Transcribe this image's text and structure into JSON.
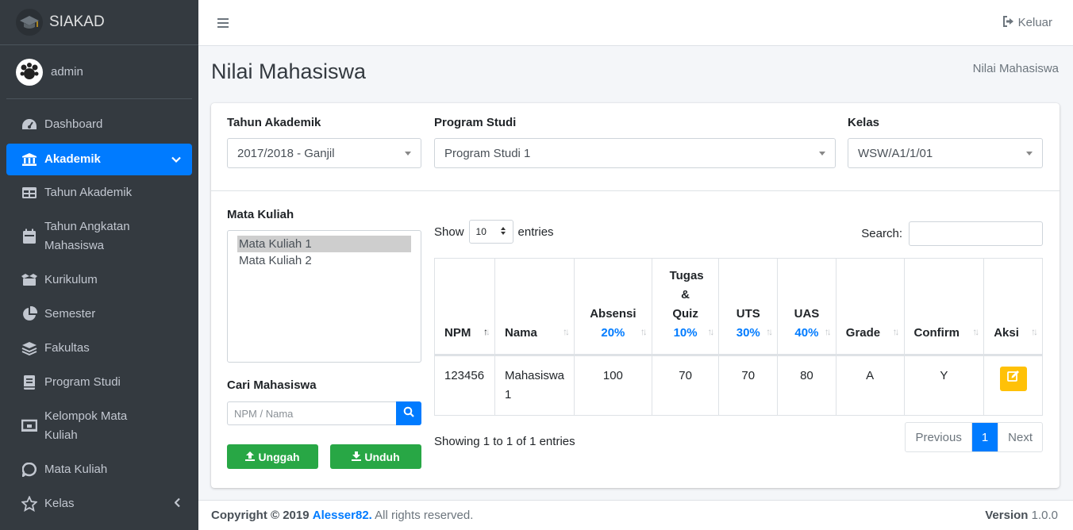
{
  "brand": {
    "name": "SIAKAD"
  },
  "user": {
    "name": "admin"
  },
  "sidebar": {
    "items": [
      {
        "label": "Dashboard",
        "icon": "dashboard-icon"
      },
      {
        "label": "Akademik",
        "icon": "bank-icon",
        "active": true
      },
      {
        "label": "Tahun Akademik",
        "icon": "table-icon"
      },
      {
        "label": "Tahun Angkatan Mahasiswa",
        "icon": "calendar-icon"
      },
      {
        "label": "Kurikulum",
        "icon": "box-open-icon"
      },
      {
        "label": "Semester",
        "icon": "pie-chart-icon"
      },
      {
        "label": "Fakultas",
        "icon": "layers-icon"
      },
      {
        "label": "Program Studi",
        "icon": "book-icon"
      },
      {
        "label": "Kelompok Mata Kuliah",
        "icon": "chalkboard-icon"
      },
      {
        "label": "Mata Kuliah",
        "icon": "comment-icon"
      },
      {
        "label": "Kelas",
        "icon": "star-icon"
      }
    ]
  },
  "navbar": {
    "logout_label": "Keluar"
  },
  "page": {
    "title": "Nilai Mahasiswa",
    "breadcrumb": "Nilai Mahasiswa"
  },
  "filters": {
    "tahun_label": "Tahun Akademik",
    "tahun_value": "2017/2018 - Ganjil",
    "prodi_label": "Program Studi",
    "prodi_value": "Program Studi 1",
    "kelas_label": "Kelas",
    "kelas_value": "WSW/A1/1/01"
  },
  "left": {
    "matkul_label": "Mata Kuliah",
    "matkul_options": [
      "Mata Kuliah 1",
      "Mata Kuliah 2"
    ],
    "cari_label": "Cari Mahasiswa",
    "cari_placeholder": "NPM / Nama",
    "unggah_label": "Unggah",
    "unduh_label": "Unduh"
  },
  "datatable": {
    "show_label": "Show",
    "length_value": "10",
    "entries_label": "entries",
    "search_label": "Search:",
    "columns": [
      {
        "label": "NPM"
      },
      {
        "label": "Nama"
      },
      {
        "label": "Absensi",
        "pct": "20%"
      },
      {
        "label": "Tugas & Quiz",
        "pct": "10%"
      },
      {
        "label": "UTS",
        "pct": "30%"
      },
      {
        "label": "UAS",
        "pct": "40%"
      },
      {
        "label": "Grade"
      },
      {
        "label": "Confirm"
      },
      {
        "label": "Aksi"
      }
    ],
    "rows": [
      {
        "npm": "123456",
        "nama": "Mahasiswa 1",
        "absensi": "100",
        "tugas": "70",
        "uts": "70",
        "uas": "80",
        "grade": "A",
        "confirm": "Y"
      }
    ],
    "info": "Showing 1 to 1 of 1 entries",
    "pager": {
      "previous": "Previous",
      "current": "1",
      "next": "Next"
    }
  },
  "footer": {
    "copyright_prefix": "Copyright © 2019",
    "author": "Alesser82.",
    "rights": "All rights reserved.",
    "version_label": "Version",
    "version_value": "1.0.0"
  },
  "colors": {
    "primary": "#007bff",
    "success": "#28a745",
    "warning": "#ffc107",
    "sidebar": "#343a40"
  }
}
